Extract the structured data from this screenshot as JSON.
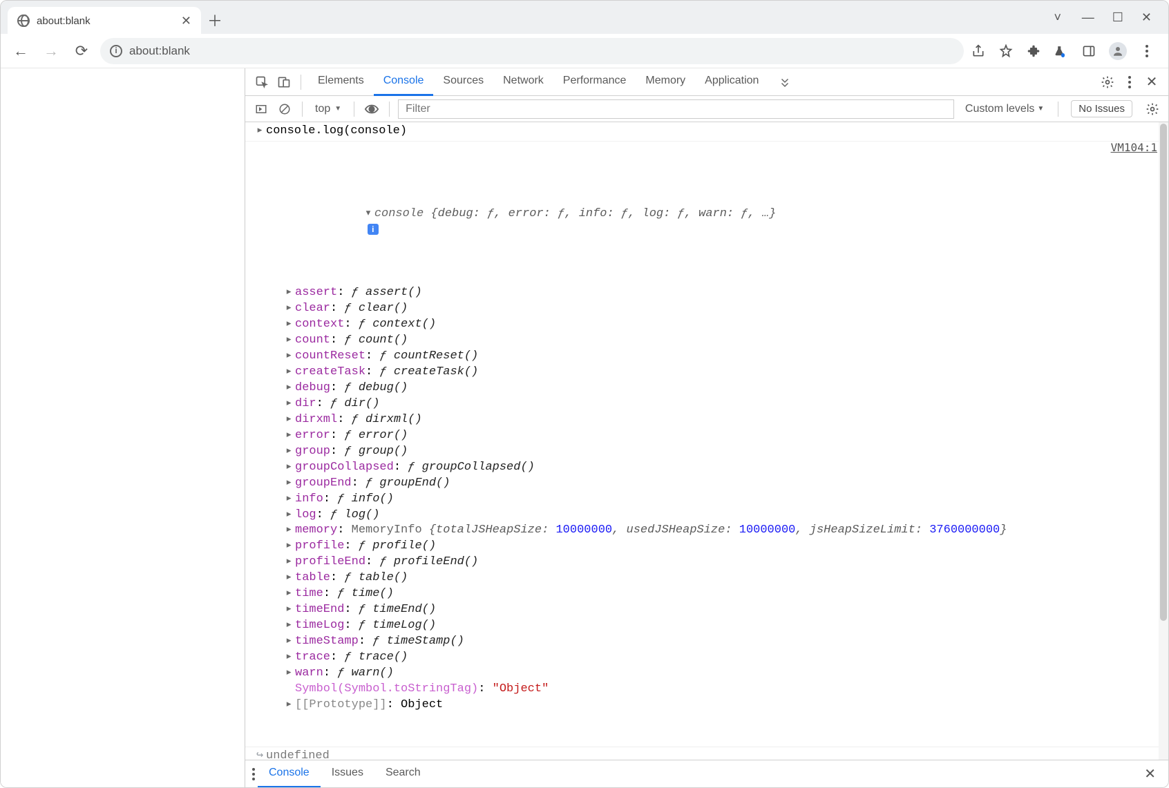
{
  "browser": {
    "tab_title": "about:blank",
    "url_display": "about:blank",
    "url_highlight_prefix": "about:"
  },
  "devtools": {
    "tabs": [
      "Elements",
      "Console",
      "Sources",
      "Network",
      "Performance",
      "Memory",
      "Application"
    ],
    "active_tab": "Console"
  },
  "console_toolbar": {
    "context": "top",
    "filter_placeholder": "Filter",
    "levels_label": "Custom levels",
    "issues_label": "No Issues"
  },
  "log": {
    "input": "console.log(console)",
    "source_ref": "VM104:1",
    "summary_prefix": "console ",
    "summary_inline": "{debug: ƒ, error: ƒ, info: ƒ, log: ƒ, warn: ƒ, …}",
    "properties": [
      {
        "key": "assert",
        "type": "fn",
        "val": "ƒ assert()"
      },
      {
        "key": "clear",
        "type": "fn",
        "val": "ƒ clear()"
      },
      {
        "key": "context",
        "type": "fn",
        "val": "ƒ context()"
      },
      {
        "key": "count",
        "type": "fn",
        "val": "ƒ count()"
      },
      {
        "key": "countReset",
        "type": "fn",
        "val": "ƒ countReset()"
      },
      {
        "key": "createTask",
        "type": "fn",
        "val": "ƒ createTask()"
      },
      {
        "key": "debug",
        "type": "fn",
        "val": "ƒ debug()"
      },
      {
        "key": "dir",
        "type": "fn",
        "val": "ƒ dir()"
      },
      {
        "key": "dirxml",
        "type": "fn",
        "val": "ƒ dirxml()"
      },
      {
        "key": "error",
        "type": "fn",
        "val": "ƒ error()"
      },
      {
        "key": "group",
        "type": "fn",
        "val": "ƒ group()"
      },
      {
        "key": "groupCollapsed",
        "type": "fn",
        "val": "ƒ groupCollapsed()"
      },
      {
        "key": "groupEnd",
        "type": "fn",
        "val": "ƒ groupEnd()"
      },
      {
        "key": "info",
        "type": "fn",
        "val": "ƒ info()"
      },
      {
        "key": "log",
        "type": "fn",
        "val": "ƒ log()"
      },
      {
        "key": "memory",
        "type": "mem",
        "prefix": "MemoryInfo ",
        "val": "{totalJSHeapSize: 10000000, usedJSHeapSize: 10000000, jsHeapSizeLimit: 3760000000}"
      },
      {
        "key": "profile",
        "type": "fn",
        "val": "ƒ profile()"
      },
      {
        "key": "profileEnd",
        "type": "fn",
        "val": "ƒ profileEnd()"
      },
      {
        "key": "table",
        "type": "fn",
        "val": "ƒ table()"
      },
      {
        "key": "time",
        "type": "fn",
        "val": "ƒ time()"
      },
      {
        "key": "timeEnd",
        "type": "fn",
        "val": "ƒ timeEnd()"
      },
      {
        "key": "timeLog",
        "type": "fn",
        "val": "ƒ timeLog()"
      },
      {
        "key": "timeStamp",
        "type": "fn",
        "val": "ƒ timeStamp()"
      },
      {
        "key": "trace",
        "type": "fn",
        "val": "ƒ trace()"
      },
      {
        "key": "warn",
        "type": "fn",
        "val": "ƒ warn()"
      }
    ],
    "symbol_key": "Symbol(Symbol.toStringTag)",
    "symbol_val": "\"Object\"",
    "proto_key": "[[Prototype]]",
    "proto_val": "Object",
    "return_value": "undefined"
  },
  "drawer": {
    "tabs": [
      "Console",
      "Issues",
      "Search"
    ],
    "active": "Console"
  }
}
